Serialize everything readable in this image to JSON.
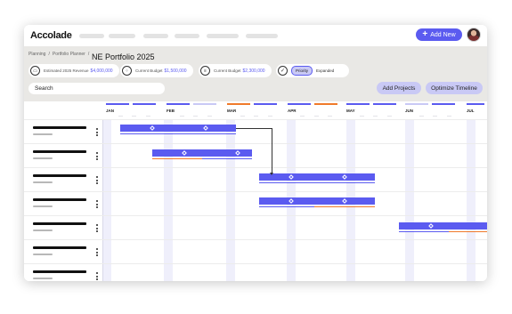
{
  "app": {
    "logo": "Accolade",
    "add_new_label": "Add New",
    "add_new_icon": "plus-icon",
    "avatar_icon": "user-avatar"
  },
  "breadcrumb": {
    "items": [
      "Planning",
      "Portfolio Planner"
    ],
    "separator": "/"
  },
  "page": {
    "title": "NE Portfolio 2025"
  },
  "stats": [
    {
      "icon": "chat-icon",
      "label": "Estimated 2025 Revenue",
      "value": "$4,000,000"
    },
    {
      "icon": "grid-icon",
      "label": "Current Budget",
      "value": "$1,500,000"
    },
    {
      "icon": "list-icon",
      "label": "Current Budget",
      "value": "$2,300,000"
    }
  ],
  "view_toggle": {
    "icon": "check-icon",
    "options": [
      "Priority",
      "Expanded"
    ],
    "selected": "Priority"
  },
  "search": {
    "placeholder": "Search"
  },
  "actions": {
    "add_projects": "Add Projects",
    "optimize_timeline": "Optimize Timeline"
  },
  "timeline": {
    "months": [
      "JAN",
      "FEB",
      "MAR",
      "APR",
      "MAY",
      "JUN",
      "JUL"
    ]
  },
  "colors": {
    "accent": "#5b5bf0",
    "accent_light": "#c9c9f5",
    "warning": "#f07a2a",
    "header_bg": "#e9e8e5"
  }
}
